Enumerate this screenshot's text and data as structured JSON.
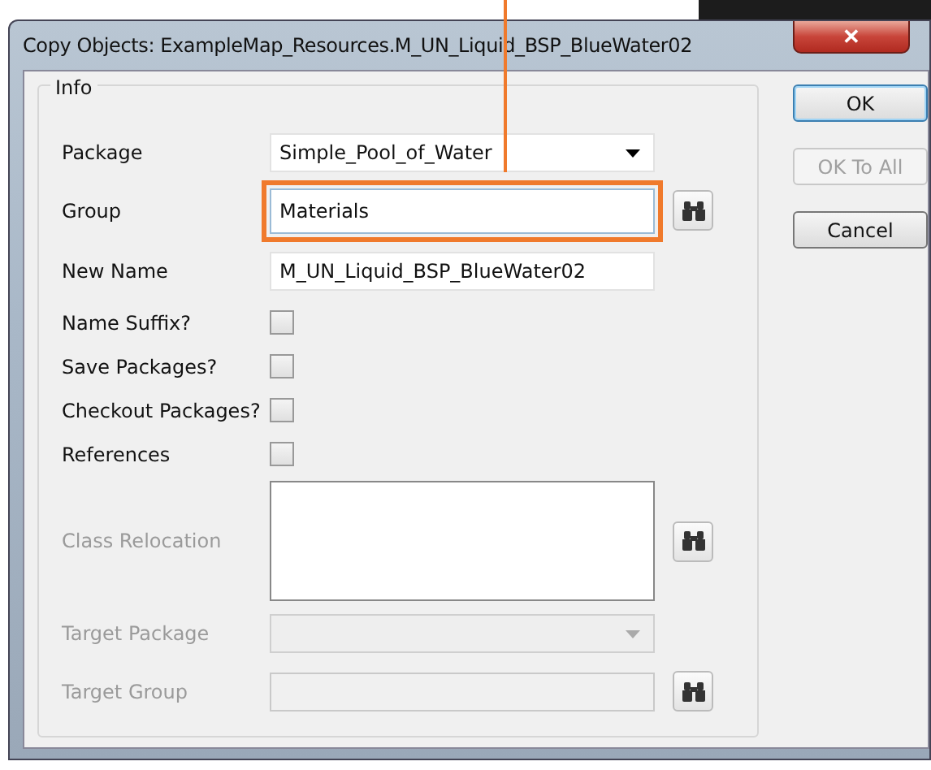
{
  "window": {
    "title": "Copy Objects: ExampleMap_Resources.M_UN_Liquid_BSP_BlueWater02",
    "close": "✕"
  },
  "group_box": {
    "title": "Info"
  },
  "rows": [
    {
      "label": "Package",
      "kind": "dropdown",
      "value": "Simple_Pool_of_Water",
      "disabled": false,
      "browse": false,
      "highlighted": false
    },
    {
      "label": "Group",
      "kind": "text",
      "value": "Materials",
      "disabled": false,
      "browse": true,
      "highlighted": true
    },
    {
      "label": "New Name",
      "kind": "text",
      "value": "M_UN_Liquid_BSP_BlueWater02",
      "disabled": false,
      "browse": false,
      "highlighted": false
    },
    {
      "label": "Name Suffix?",
      "kind": "checkbox",
      "checked": false,
      "disabled": false
    },
    {
      "label": "Save Packages?",
      "kind": "checkbox",
      "checked": false,
      "disabled": false
    },
    {
      "label": "Checkout Packages?",
      "kind": "checkbox",
      "checked": false,
      "disabled": false
    },
    {
      "label": "References",
      "kind": "checkbox",
      "checked": false,
      "disabled": false
    },
    {
      "label": "Class Relocation",
      "kind": "textarea",
      "disabled": true,
      "browse": true,
      "highlighted": false
    },
    {
      "label": "Target Package",
      "kind": "dropdown",
      "disabled": true,
      "browse": false,
      "highlighted": false
    },
    {
      "label": "Target Group",
      "kind": "text",
      "disabled": true,
      "browse": true,
      "highlighted": false
    }
  ],
  "buttons": [
    {
      "label": "OK",
      "default": true,
      "disabled": false
    },
    {
      "label": "OK To All",
      "default": false,
      "disabled": true
    },
    {
      "label": "Cancel",
      "default": false,
      "disabled": false
    }
  ]
}
